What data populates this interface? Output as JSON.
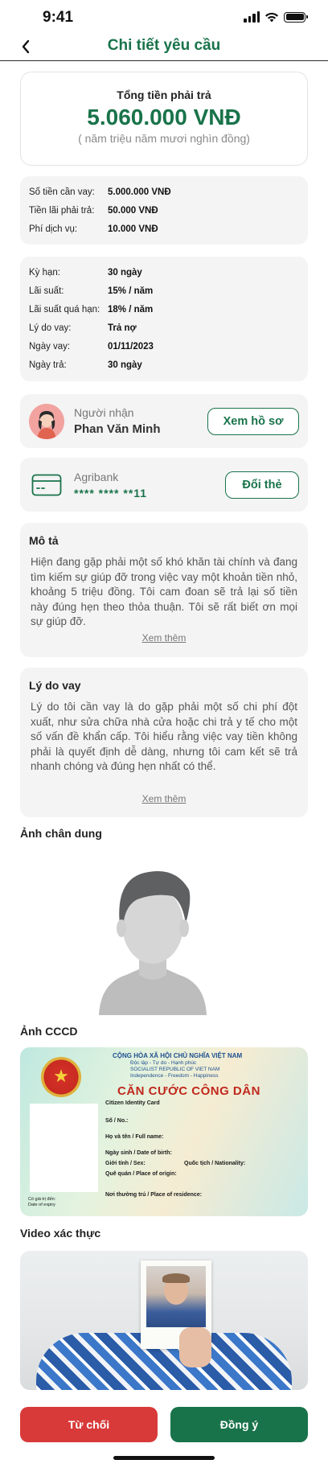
{
  "status_bar": {
    "time": "9:41"
  },
  "header": {
    "title": "Chi tiết yêu cầu"
  },
  "total": {
    "label": "Tổng tiền phải trả",
    "amount": "5.060.000 VNĐ",
    "in_words": "( năm triệu năm mươi nghìn đồng)"
  },
  "fees": [
    {
      "label": "Số tiền cần vay:",
      "value": "5.000.000 VNĐ"
    },
    {
      "label": "Tiền lãi phải trả:",
      "value": "50.000 VNĐ"
    },
    {
      "label": "Phí dịch vụ:",
      "value": "10.000 VNĐ"
    }
  ],
  "loan": [
    {
      "label": "Kỳ hạn:",
      "value": "30 ngày"
    },
    {
      "label": "Lãi suất:",
      "value": "15% / năm"
    },
    {
      "label": "Lãi suất quá hạn:",
      "value": "18% / năm"
    },
    {
      "label": "Lý do vay:",
      "value": "Trả nợ"
    },
    {
      "label": "Ngày vay:",
      "value": "01/11/2023"
    },
    {
      "label": "Ngày trả:",
      "value": "30 ngày"
    }
  ],
  "recipient": {
    "label": "Người nhận",
    "name": "Phan Văn Minh",
    "button": "Xem hồ sơ"
  },
  "bank": {
    "name": "Agribank",
    "number": "**** **** **11",
    "button": "Đổi thẻ"
  },
  "description": {
    "title": "Mô tả",
    "body": "Hiện đang gặp phải một số khó khăn tài chính và đang tìm kiếm sự giúp đỡ trong việc vay một khoản tiền nhỏ, khoảng 5 triệu đồng. Tôi cam đoan sẽ trả lại số tiền này đúng hẹn theo thỏa thuận. Tôi sẽ rất biết ơn mọi sự giúp đỡ.",
    "see_more": "Xem thêm"
  },
  "reason": {
    "title": "Lý do vay",
    "body": "Lý do tôi cần vay là do gặp phải một số chi phí đột xuất, như sửa chữa nhà cửa hoặc chi trả y tế cho một số vấn đề khẩn cấp. Tôi hiểu rằng việc vay tiền không phải là quyết định dễ dàng, nhưng tôi cam kết sẽ trả nhanh chóng và đúng hẹn nhất có thể.",
    "see_more": "Xem thêm"
  },
  "portrait": {
    "title": "Ảnh chân dung"
  },
  "id_card": {
    "title": "Ảnh CCCD",
    "header": "CỘNG HÒA XÃ HỘI CHỦ NGHĨA VIỆT NAM",
    "motto": "Độc lập - Tự do - Hạnh phúc",
    "republic_en": "SOCIALIST REPUBLIC OF VIET NAM",
    "motto_en": "Independence - Freedom - Happiness",
    "card_title": "CĂN CƯỚC CÔNG DÂN",
    "card_title_en": "Citizen Identity Card",
    "field_no": "Số / No.:",
    "field_name": "Họ và tên / Full name:",
    "field_dob": "Ngày sinh / Date of birth:",
    "field_sex": "Giới tính / Sex:",
    "field_nationality": "Quốc tịch / Nationality:",
    "field_origin": "Quê quán / Place of origin:",
    "field_residence": "Nơi thường trú / Place of residence:",
    "expiry": "Có giá trị đến:",
    "expiry_en": "Date of expiry"
  },
  "video": {
    "title": "Video xác thực"
  },
  "actions": {
    "reject": "Từ chối",
    "approve": "Đồng ý"
  },
  "colors": {
    "brand_green": "#19734a",
    "reject_red": "#d83a3a"
  }
}
